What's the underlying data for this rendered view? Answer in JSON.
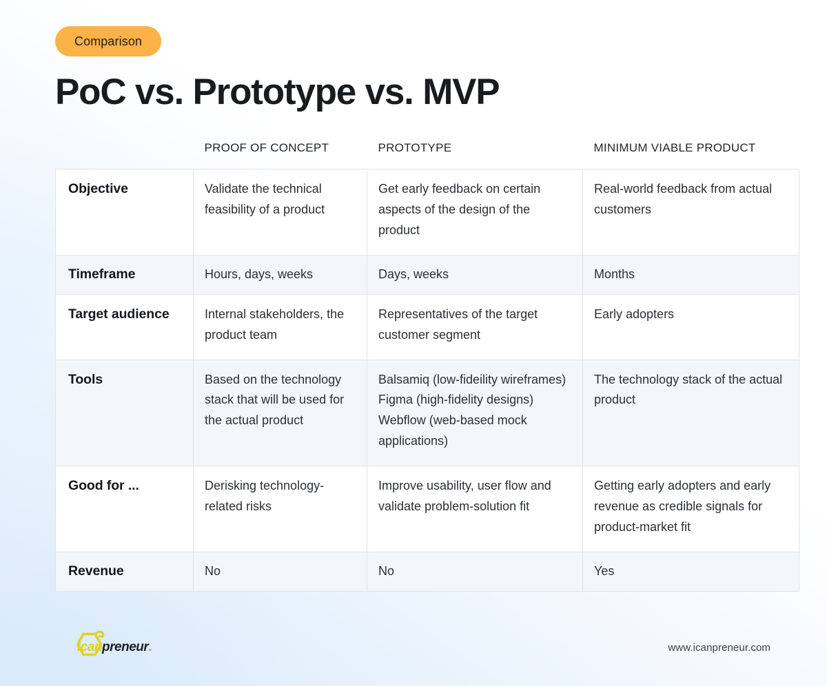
{
  "badge": {
    "label": "Comparison"
  },
  "header": {
    "title": "PoC vs. Prototype vs. MVP"
  },
  "table": {
    "columns": [
      {
        "key": "label",
        "label": ""
      },
      {
        "key": "poc",
        "label": "PROOF OF CONCEPT"
      },
      {
        "key": "prototype",
        "label": "PROTOTYPE"
      },
      {
        "key": "mvp",
        "label": "MINIMUM VIABLE PRODUCT"
      }
    ],
    "rows": [
      {
        "label": "Objective",
        "poc": "Validate the technical feasibility of a product",
        "prototype": "Get early feedback on certain aspects of the design of the product",
        "mvp": "Real-world feedback from actual customers"
      },
      {
        "label": "Timeframe",
        "poc": "Hours, days, weeks",
        "prototype": "Days, weeks",
        "mvp": "Months"
      },
      {
        "label": "Target audience",
        "poc": "Internal stakeholders, the product team",
        "prototype": "Representatives of the target customer segment",
        "mvp": "Early adopters"
      },
      {
        "label": "Tools",
        "poc": "Based on the technology stack that will be used for the actual product",
        "prototype": "Balsamiq (low-fideility wireframes)\nFigma (high-fidelity designs)\nWebflow (web-based mock applications)",
        "mvp": "The technology stack of the actual product"
      },
      {
        "label": "Good for ...",
        "poc": "Derisking technology-related risks",
        "prototype": "Improve usability, user flow and validate problem-solution fit",
        "mvp": "Getting early adopters and early revenue as credible signals for product-market fit"
      },
      {
        "label": "Revenue",
        "poc": "No",
        "prototype": "No",
        "mvp": "Yes"
      }
    ]
  },
  "footer": {
    "logo_brand": "ican",
    "logo_suffix": "preneur",
    "logo_dot": ".",
    "url": "www.icanpreneur.com"
  },
  "colors": {
    "badge_bg": "#fbb247",
    "title": "#191c1f",
    "row_tint": "#f4f7fa",
    "border": "#e0e4e9",
    "logo_yellow": "#e3d01d",
    "bg_blue": "#ddecfb"
  }
}
